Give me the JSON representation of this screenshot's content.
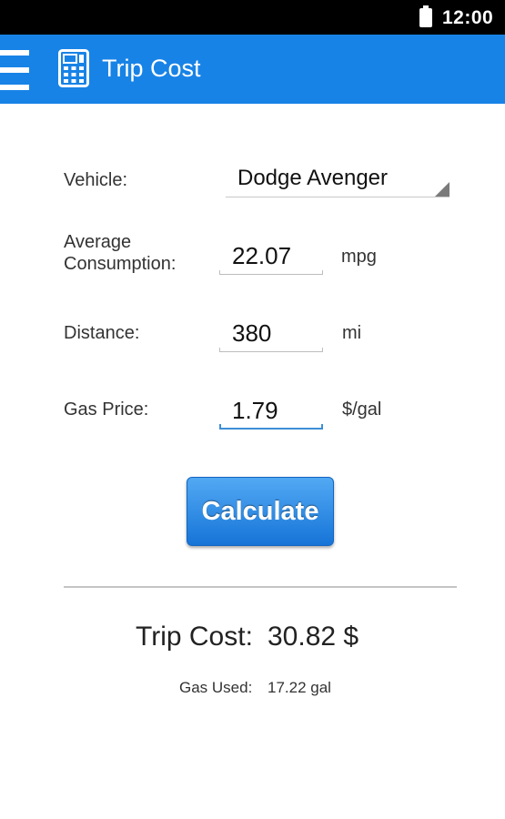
{
  "status_bar": {
    "time": "12:00",
    "battery_icon": "battery-full-icon"
  },
  "app_bar": {
    "menu_icon": "hamburger-menu-icon",
    "app_icon": "calculator-icon",
    "title": "Trip Cost",
    "color": "#1883e6"
  },
  "form": {
    "vehicle": {
      "label": "Vehicle:",
      "selected": "Dodge Avenger"
    },
    "consumption": {
      "label_line1": "Average",
      "label_line2": "Consumption:",
      "value": "22.07",
      "unit": "mpg"
    },
    "distance": {
      "label": "Distance:",
      "value": "380",
      "unit": "mi"
    },
    "gas_price": {
      "label": "Gas Price:",
      "value": "1.79",
      "unit": "$/gal"
    }
  },
  "calculate_button": {
    "label": "Calculate"
  },
  "results": {
    "trip_cost_label": "Trip Cost:",
    "trip_cost_value": "30.82 $",
    "gas_used_label": "Gas Used:",
    "gas_used_value": "17.22 gal"
  }
}
